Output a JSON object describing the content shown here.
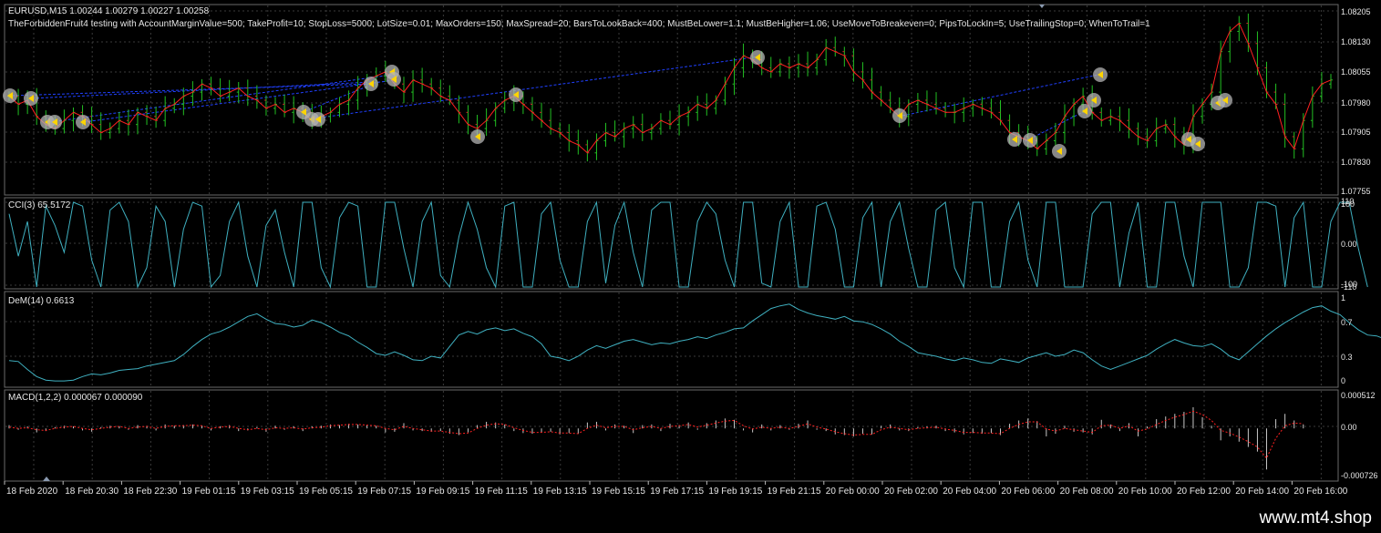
{
  "main": {
    "symbol_line": "EURUSD,M15  1.00244 1.00279 1.00227 1.00258",
    "ea_settings": "TheForbiddenFruit4 testing with AccountMarginValue=500; TakeProfit=10; StopLoss=5000; LotSize=0.01; MaxOrders=150; MaxSpread=20; BarsToLookBack=400; MustBeLower=1.1; MustBeHigher=1.06; UseMoveToBreakeven=0; PipsToLockIn=5; UseTrailingStop=0; WhenToTrail=1",
    "price_scale": [
      "1.08205",
      "1.08130",
      "1.08055",
      "1.07980",
      "1.07905",
      "1.07830",
      "1.07755"
    ]
  },
  "cci": {
    "label": "CCI(3) 65.5172",
    "scale": [
      "110",
      "100",
      "0.00",
      "-100",
      "-110"
    ]
  },
  "dem": {
    "label": "DeM(14) 0.6613",
    "scale": [
      "1",
      "0.7",
      "0.3",
      "0"
    ]
  },
  "macd": {
    "label": "MACD(1,2,2) 0.000067 0.000090",
    "scale": [
      "0.000512",
      "0.00",
      "-0.000726"
    ]
  },
  "time_axis": [
    "18 Feb 2020",
    "18 Feb 20:30",
    "18 Feb 22:30",
    "19 Feb 01:15",
    "19 Feb 03:15",
    "19 Feb 05:15",
    "19 Feb 07:15",
    "19 Feb 09:15",
    "19 Feb 11:15",
    "19 Feb 13:15",
    "19 Feb 15:15",
    "19 Feb 17:15",
    "19 Feb 19:15",
    "19 Feb 21:15",
    "20 Feb 00:00",
    "20 Feb 02:00",
    "20 Feb 04:00",
    "20 Feb 06:00",
    "20 Feb 08:00",
    "20 Feb 10:00",
    "20 Feb 12:00",
    "20 Feb 14:00",
    "20 Feb 16:00"
  ],
  "watermark": "www.mt4.shop",
  "colors": {
    "bull": "#22c022",
    "bear": "#c82828",
    "price_line": "#ff2020",
    "cci": "#3fb0c0",
    "dem": "#3fb0c0",
    "macd_hist": "#c8c8c8",
    "macd_signal": "#ff2020",
    "grid": "#3a3a3a",
    "trade_link": "#2040ff",
    "marker": "#b4b4b4"
  },
  "chart_data": [
    {
      "type": "line",
      "title": "EURUSD,M15",
      "ylim": [
        1.07755,
        1.08205
      ],
      "series": [
        {
          "values": [
            1.0799,
            1.0797,
            1.0798,
            1.0794,
            1.0792,
            1.0791,
            1.0793,
            1.0795,
            1.0794,
            1.0792,
            1.079,
            1.0791,
            1.0793,
            1.0792,
            1.0795,
            1.0794,
            1.0793,
            1.0796,
            1.0797,
            1.0799,
            1.08,
            1.0802,
            1.0801,
            1.0799,
            1.08,
            1.0801,
            1.0799,
            1.0798,
            1.0796,
            1.0797,
            1.0795,
            1.0796,
            1.0795,
            1.0793,
            1.0794,
            1.0795,
            1.0797,
            1.0798,
            1.0801,
            1.0803,
            1.0804,
            1.0805,
            1.0802,
            1.08,
            1.0803,
            1.0802,
            1.0801,
            1.0799,
            1.0798,
            1.0795,
            1.0792,
            1.0791,
            1.0793,
            1.0796,
            1.0798,
            1.0799,
            1.0797,
            1.0795,
            1.0793,
            1.0791,
            1.079,
            1.0788,
            1.0787,
            1.0785,
            1.0788,
            1.079,
            1.0789,
            1.0791,
            1.0792,
            1.079,
            1.0791,
            1.0793,
            1.0792,
            1.0794,
            1.0795,
            1.0797,
            1.0796,
            1.0798,
            1.0802,
            1.0806,
            1.0809,
            1.0808,
            1.0806,
            1.0805,
            1.0807,
            1.0806,
            1.0807,
            1.0806,
            1.0808,
            1.0811,
            1.081,
            1.0809,
            1.0805,
            1.0803,
            1.08,
            1.0798,
            1.0796,
            1.0794,
            1.0797,
            1.0798,
            1.0797,
            1.0796,
            1.0795,
            1.0795,
            1.0796,
            1.0797,
            1.0796,
            1.0795,
            1.0793,
            1.079,
            1.0789,
            1.0788,
            1.0786,
            1.0788,
            1.079,
            1.0794,
            1.0797,
            1.0799,
            1.0795,
            1.0793,
            1.0794,
            1.0793,
            1.0791,
            1.0789,
            1.0788,
            1.0791,
            1.0792,
            1.0789,
            1.0787,
            1.0794,
            1.0797,
            1.08,
            1.081,
            1.0815,
            1.0817,
            1.0812,
            1.0806,
            1.08,
            1.0797,
            1.0789,
            1.0786,
            1.0793,
            1.0799,
            1.0802,
            1.0803
          ]
        }
      ]
    },
    {
      "type": "line",
      "title": "CCI(3)",
      "ylim": [
        -110,
        110
      ],
      "series": [
        {
          "values": [
            80,
            -30,
            60,
            -110,
            100,
            50,
            -20,
            110,
            100,
            -40,
            -110,
            90,
            110,
            60,
            -110,
            -60,
            100,
            60,
            -110,
            40,
            110,
            100,
            -110,
            -80,
            60,
            110,
            -30,
            -110,
            50,
            90,
            -20,
            -110,
            110,
            110,
            -60,
            -110,
            70,
            110,
            100,
            -110,
            -110,
            110,
            110,
            -10,
            -110,
            60,
            110,
            -80,
            -110,
            20,
            110,
            40,
            -60,
            -110,
            100,
            110,
            -110,
            -110,
            80,
            110,
            -40,
            -110,
            -110,
            60,
            110,
            -100,
            50,
            110,
            -20,
            -110,
            90,
            110,
            110,
            -110,
            -110,
            60,
            110,
            80,
            -40,
            -110,
            110,
            110,
            -100,
            -110,
            60,
            110,
            -110,
            -110,
            100,
            110,
            40,
            -110,
            -110,
            70,
            110,
            -110,
            60,
            110,
            -10,
            -110,
            -110,
            90,
            110,
            -60,
            -110,
            110,
            110,
            -110,
            -110,
            60,
            110,
            -40,
            -110,
            110,
            110,
            -110,
            -110,
            -110,
            80,
            110,
            110,
            -110,
            30,
            110,
            -110,
            -110,
            110,
            110,
            -30,
            -110,
            110,
            110,
            110,
            -110,
            -110,
            -60,
            110,
            110,
            100,
            -110,
            70,
            110,
            -110,
            -110,
            60,
            110,
            110,
            -10,
            -110
          ]
        }
      ]
    },
    {
      "type": "line",
      "title": "DeM(14)",
      "ylim": [
        0,
        1
      ],
      "series": [
        {
          "values": [
            0.28,
            0.27,
            0.18,
            0.1,
            0.06,
            0.05,
            0.05,
            0.06,
            0.1,
            0.13,
            0.12,
            0.14,
            0.17,
            0.18,
            0.19,
            0.22,
            0.24,
            0.26,
            0.28,
            0.35,
            0.44,
            0.52,
            0.58,
            0.61,
            0.66,
            0.72,
            0.78,
            0.81,
            0.75,
            0.7,
            0.69,
            0.66,
            0.68,
            0.74,
            0.71,
            0.66,
            0.6,
            0.56,
            0.49,
            0.43,
            0.36,
            0.34,
            0.38,
            0.34,
            0.29,
            0.28,
            0.33,
            0.31,
            0.44,
            0.57,
            0.61,
            0.58,
            0.63,
            0.65,
            0.62,
            0.64,
            0.59,
            0.55,
            0.47,
            0.33,
            0.31,
            0.28,
            0.33,
            0.4,
            0.45,
            0.42,
            0.46,
            0.5,
            0.52,
            0.49,
            0.46,
            0.48,
            0.47,
            0.5,
            0.52,
            0.55,
            0.53,
            0.57,
            0.6,
            0.64,
            0.65,
            0.73,
            0.8,
            0.87,
            0.9,
            0.92,
            0.86,
            0.82,
            0.79,
            0.77,
            0.75,
            0.78,
            0.73,
            0.72,
            0.69,
            0.64,
            0.58,
            0.5,
            0.44,
            0.37,
            0.35,
            0.33,
            0.3,
            0.28,
            0.31,
            0.29,
            0.26,
            0.25,
            0.3,
            0.28,
            0.26,
            0.31,
            0.34,
            0.37,
            0.33,
            0.35,
            0.4,
            0.37,
            0.29,
            0.22,
            0.18,
            0.22,
            0.26,
            0.3,
            0.34,
            0.41,
            0.47,
            0.52,
            0.48,
            0.45,
            0.44,
            0.47,
            0.41,
            0.33,
            0.29,
            0.38,
            0.47,
            0.56,
            0.64,
            0.71,
            0.77,
            0.83,
            0.88,
            0.9,
            0.84,
            0.8,
            0.71,
            0.63,
            0.57,
            0.56,
            0.52,
            0.55,
            0.55,
            0.52,
            0.41,
            0.33
          ]
        }
      ]
    },
    {
      "type": "bar",
      "title": "MACD(1,2,2)",
      "ylim": [
        -0.000726,
        0.000512
      ],
      "series": [
        {
          "values": [
            5e-05,
            -2e-05,
            3e-05,
            -6e-05,
            -4e-05,
            2e-05,
            4e-05,
            3e-05,
            -3e-05,
            -5e-05,
            2e-05,
            4e-05,
            3e-05,
            -2e-05,
            5e-05,
            4e-05,
            -3e-05,
            6e-05,
            4e-05,
            5e-05,
            6e-05,
            4e-05,
            -3e-05,
            3e-05,
            5e-05,
            -4e-05,
            -3e-05,
            2e-05,
            -5e-05,
            4e-05,
            -2e-05,
            3e-05,
            -4e-05,
            3e-05,
            4e-05,
            6e-05,
            5e-05,
            7e-05,
            6e-05,
            5e-05,
            4e-05,
            -6e-05,
            -5e-05,
            8e-05,
            -3e-05,
            -4e-05,
            -5e-05,
            -4e-05,
            -8e-05,
            -0.0001,
            -6e-05,
            5e-05,
            0.0001,
            9e-05,
            6e-05,
            -4e-05,
            -7e-05,
            -8e-05,
            -6e-05,
            -5e-05,
            -9e-05,
            -7e-05,
            -8e-05,
            9e-05,
            0.0001,
            -3e-05,
            6e-05,
            4e-05,
            -7e-05,
            5e-05,
            6e-05,
            -4e-05,
            7e-05,
            5e-05,
            9e-05,
            -2e-05,
            8e-05,
            0.00012,
            0.00015,
            0.00013,
            -3e-05,
            -6e-05,
            6e-05,
            -3e-05,
            5e-05,
            -2e-05,
            7e-05,
            0.00012,
            -2e-05,
            -4e-05,
            -9e-05,
            -0.0001,
            -0.00012,
            -8e-05,
            -9e-05,
            4e-05,
            6e-05,
            -3e-05,
            -4e-05,
            2e-05,
            3e-05,
            4e-05,
            -4e-05,
            -6e-05,
            -9e-05,
            -7e-05,
            -8e-05,
            -7e-05,
            -0.0001,
            7e-05,
            0.00012,
            0.00015,
            0.00011,
            -0.00012,
            -8e-05,
            4e-05,
            -5e-05,
            -6e-05,
            -9e-05,
            0.00013,
            6e-05,
            -4e-05,
            8e-05,
            -0.00012,
            3e-05,
            0.00014,
            0.00018,
            0.00022,
            0.00025,
            0.00032,
            0.00017,
            4e-05,
            -0.00018,
            -0.00012,
            -0.0002,
            -0.00028,
            -0.00035,
            -0.00062,
            0.00014,
            0.00022,
            0.00012,
            6e-05
          ]
        },
        {
          "values": [
            2e-05,
            0.0,
            1e-05,
            -2e-05,
            -3e-05,
            0.0,
            2e-05,
            3e-05,
            0.0,
            -2e-05,
            0.0,
            2e-05,
            3e-05,
            0.0,
            2e-05,
            3e-05,
            0.0,
            3e-05,
            4e-05,
            4e-05,
            5e-05,
            4e-05,
            0.0,
            2e-05,
            3e-05,
            0.0,
            -2e-05,
            0.0,
            -2e-05,
            1e-05,
            0.0,
            1e-05,
            -1e-05,
            1e-05,
            2e-05,
            4e-05,
            5e-05,
            6e-05,
            6e-05,
            5e-05,
            4e-05,
            0.0,
            -2e-05,
            3e-05,
            0.0,
            -2e-05,
            -4e-05,
            -4e-05,
            -6e-05,
            -8e-05,
            -7e-05,
            0.0,
            5e-05,
            7e-05,
            6e-05,
            1e-05,
            -3e-05,
            -6e-05,
            -6e-05,
            -5e-05,
            -7e-05,
            -7e-05,
            -8e-05,
            0.0,
            5e-05,
            1e-05,
            3e-05,
            3e-05,
            -2e-05,
            1e-05,
            3e-05,
            0.0,
            3e-05,
            4e-05,
            6e-05,
            2e-05,
            5e-05,
            8e-05,
            0.00011,
            0.00012,
            4e-05,
            -1e-05,
            2e-05,
            0.0,
            2e-05,
            0.0,
            3e-05,
            7e-05,
            2e-05,
            -1e-05,
            -5e-05,
            -8e-05,
            -0.0001,
            -9e-05,
            -9e-05,
            -2e-05,
            2e-05,
            0.0,
            -2e-05,
            0.0,
            1e-05,
            2e-05,
            -1e-05,
            -3e-05,
            -6e-05,
            -6e-05,
            -7e-05,
            -7e-05,
            -8e-05,
            0.0,
            6e-05,
            0.0001,
            0.0001,
            -1e-05,
            -4e-05,
            0.0,
            -2e-05,
            -4e-05,
            -6e-05,
            4e-05,
            5e-05,
            0.0,
            4e-05,
            -4e-05,
            -1e-05,
            6e-05,
            0.00012,
            0.00017,
            0.00021,
            0.00026,
            0.00021,
            0.00012,
            -3e-05,
            -7e-05,
            -0.00013,
            -0.0002,
            -0.00028,
            -0.00045,
            -0.00015,
            4e-05,
            8e-05,
            7e-05
          ]
        }
      ]
    }
  ]
}
